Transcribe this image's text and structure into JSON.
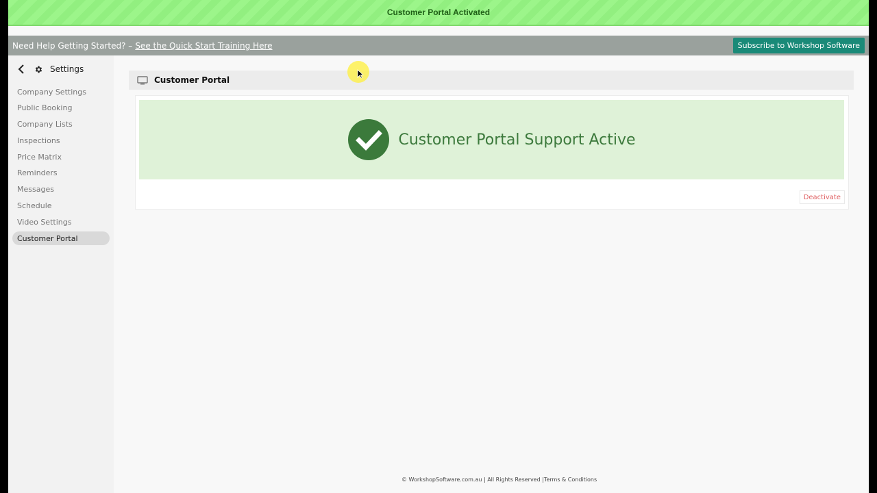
{
  "toast": {
    "message": "Customer Portal Activated",
    "color": "#9cf58a"
  },
  "help_bar": {
    "text": "Need Help Getting Started? –",
    "link": "See the Quick Start Training Here",
    "subscribe_button": "Subscribe to Workshop Software"
  },
  "sidebar": {
    "title": "Settings",
    "back_icon": "chevron-left-icon",
    "settings_icon": "gear-icon",
    "items": [
      {
        "label": "Company Settings",
        "active": false
      },
      {
        "label": "Public Booking",
        "active": false
      },
      {
        "label": "Company Lists",
        "active": false
      },
      {
        "label": "Inspections",
        "active": false
      },
      {
        "label": "Price Matrix",
        "active": false
      },
      {
        "label": "Reminders",
        "active": false
      },
      {
        "label": "Messages",
        "active": false
      },
      {
        "label": "Schedule",
        "active": false
      },
      {
        "label": "Video Settings",
        "active": false
      },
      {
        "label": "Customer Portal",
        "active": true
      }
    ]
  },
  "main": {
    "card_title": "Customer Portal",
    "card_icon": "monitor-icon",
    "status_icon": "check-circle-icon",
    "status_message": "Customer Portal Support Active",
    "status_color": "#3d7a3d",
    "deactivate_button": "Deactivate"
  },
  "footer": {
    "copyright": "© WorkshopSoftware.com.au | All Rights Reserved |",
    "terms_link": "Terms & Conditions"
  }
}
